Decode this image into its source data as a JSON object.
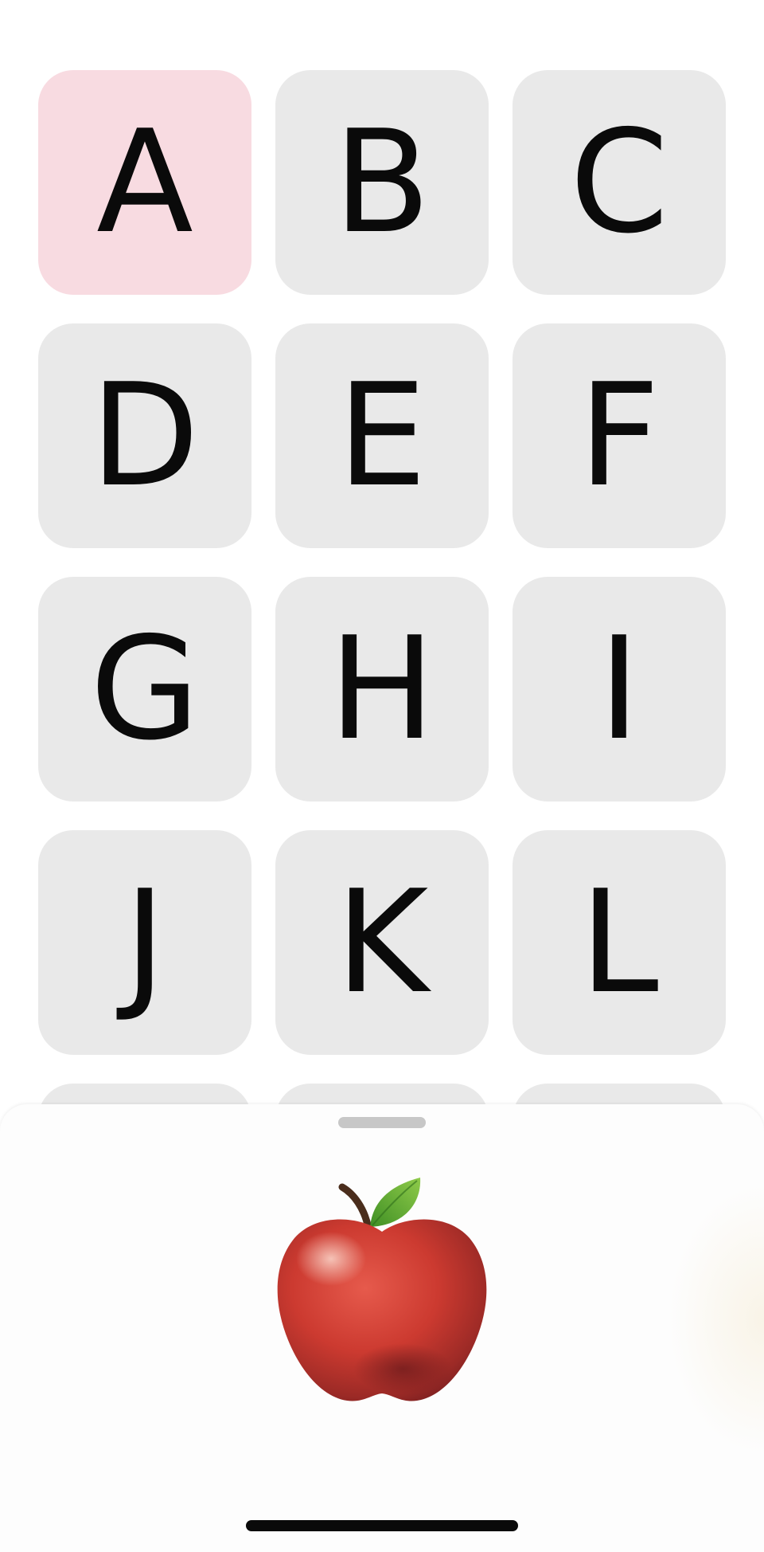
{
  "tiles": [
    {
      "letter": "A",
      "selected": true
    },
    {
      "letter": "B",
      "selected": false
    },
    {
      "letter": "C",
      "selected": false
    },
    {
      "letter": "D",
      "selected": false
    },
    {
      "letter": "E",
      "selected": false
    },
    {
      "letter": "F",
      "selected": false
    },
    {
      "letter": "G",
      "selected": false
    },
    {
      "letter": "H",
      "selected": false
    },
    {
      "letter": "I",
      "selected": false
    },
    {
      "letter": "J",
      "selected": false
    },
    {
      "letter": "K",
      "selected": false
    },
    {
      "letter": "L",
      "selected": false
    }
  ],
  "colors": {
    "tile_bg": "#e9e9e9",
    "selected_bg": "#f8dbe1",
    "letter": "#0a0a0a",
    "sheet_bg": "#fdfdfd"
  },
  "sheet": {
    "image_icon": "red-apple-emoji"
  }
}
